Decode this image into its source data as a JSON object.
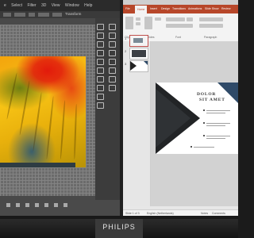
{
  "monitor": {
    "brand": "PHILIPS"
  },
  "photoshop": {
    "menu": [
      "e",
      "Select",
      "Filter",
      "3D",
      "View",
      "Window",
      "Help"
    ],
    "options_label": "Transform"
  },
  "powerpoint": {
    "tabs": [
      "File",
      "Home",
      "Insert",
      "Design",
      "Transitions",
      "Animations",
      "Slide Show",
      "Review"
    ],
    "active_tab": "Home",
    "ribbon_groups": [
      "Clipboard",
      "Slides",
      "Font",
      "Paragraph"
    ],
    "thumbnail_numbers": [
      "1",
      "2",
      "3"
    ],
    "slide_title_line1": "DOLOR",
    "slide_title_line2": "SIT AMET",
    "status": {
      "slide_info": "Slide 1 of 3",
      "language": "English (Netherlands)",
      "notes": "Notes",
      "comments": "Comments"
    }
  }
}
